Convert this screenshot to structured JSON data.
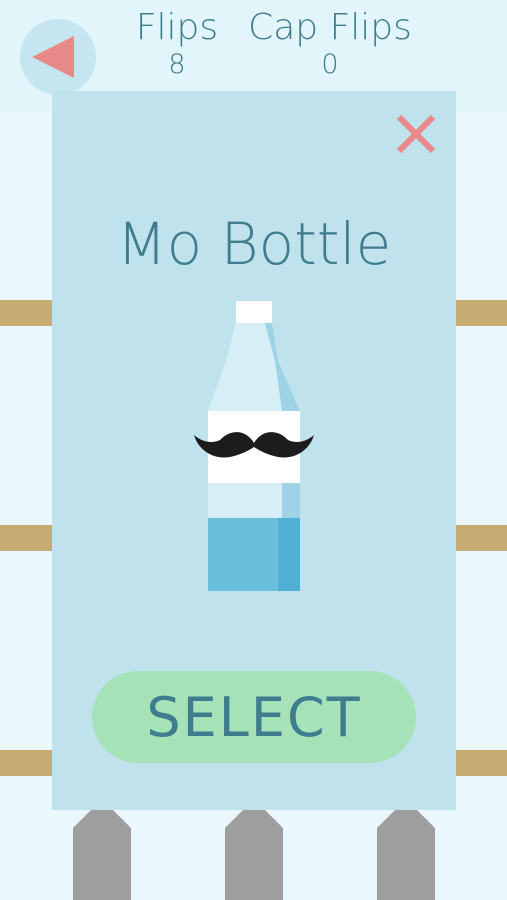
{
  "header": {
    "flips_label": "Flips",
    "flips_value": "8",
    "cap_flips_label": "Cap Flips",
    "cap_flips_value": "0"
  },
  "panel": {
    "title": "Mo Bottle",
    "select_label": "SELECT"
  },
  "icons": {
    "back": "back-arrow-icon",
    "close": "close-icon",
    "mustache": "mustache-icon"
  },
  "colors": {
    "background": "#eaf7fc",
    "panel": "#bfe2ed",
    "text": "#3f7c8d",
    "accent_red": "#e88a8a",
    "select_button": "#a6e2b8",
    "shelf": "#c6ac73",
    "post": "#9e9e9e",
    "water": "#6cbfdb"
  }
}
